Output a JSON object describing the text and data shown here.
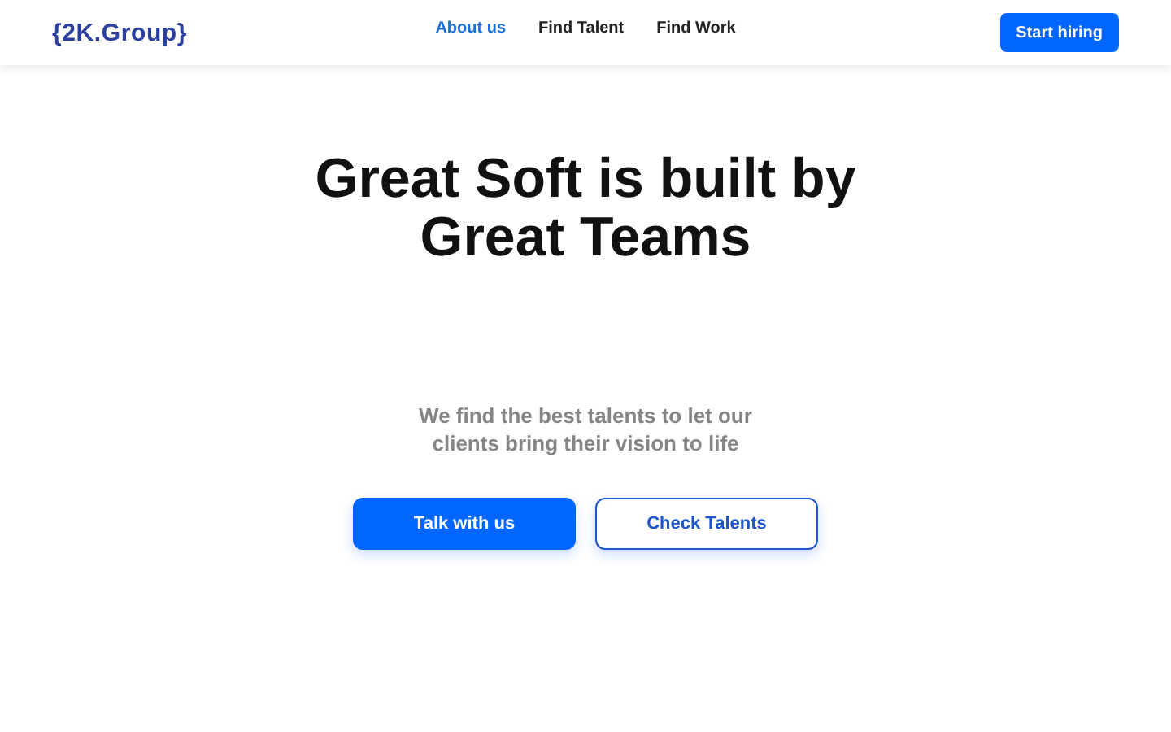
{
  "header": {
    "logo": "{2K.Group}",
    "nav": [
      {
        "label": "About us",
        "selected": true
      },
      {
        "label": "Find Talent",
        "selected": false
      },
      {
        "label": "Find Work",
        "selected": false
      }
    ],
    "cta": "Start hiring"
  },
  "hero": {
    "title_lines": [
      "Great Soft is built by",
      "Great Teams"
    ],
    "subtitle": "We find the best talents to let our clients bring their vision to life",
    "buttons": [
      {
        "label": "Talk with us",
        "kind": "primary"
      },
      {
        "label": "Check Talents",
        "kind": "outline"
      }
    ]
  }
}
